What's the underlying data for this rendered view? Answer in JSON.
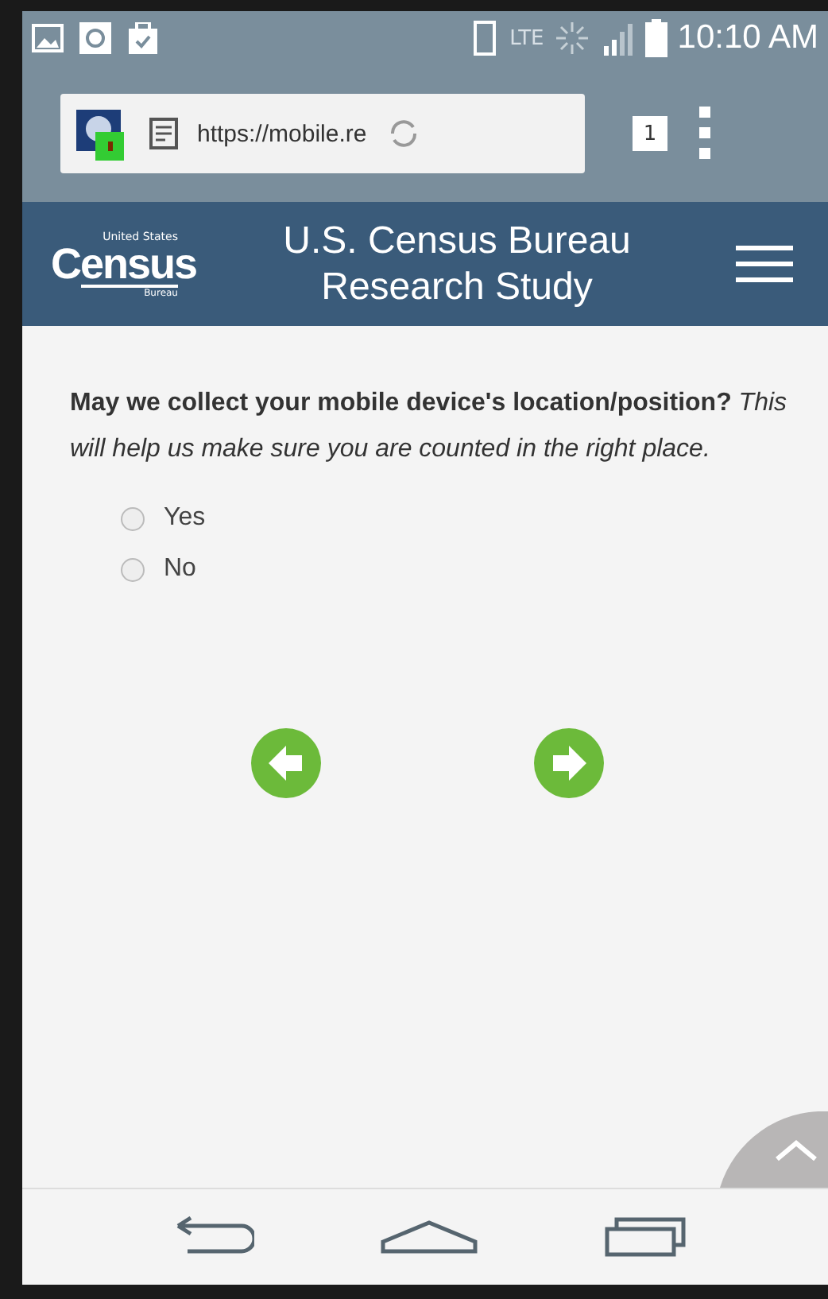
{
  "status_bar": {
    "network": "LTE",
    "time": "10:10 AM"
  },
  "browser": {
    "url": "https://mobile.re",
    "tab_count": "1"
  },
  "header": {
    "logo": {
      "top": "United States",
      "main": "Census",
      "bottom": "Bureau"
    },
    "title": "U.S. Census Bureau Research Study"
  },
  "question": {
    "text": "**May we collect your mobile device's location/position?** *This will help us make sure you are counted in the right place.*",
    "options": [
      {
        "label": "Yes",
        "selected": false
      },
      {
        "label": "No",
        "selected": false
      }
    ]
  }
}
